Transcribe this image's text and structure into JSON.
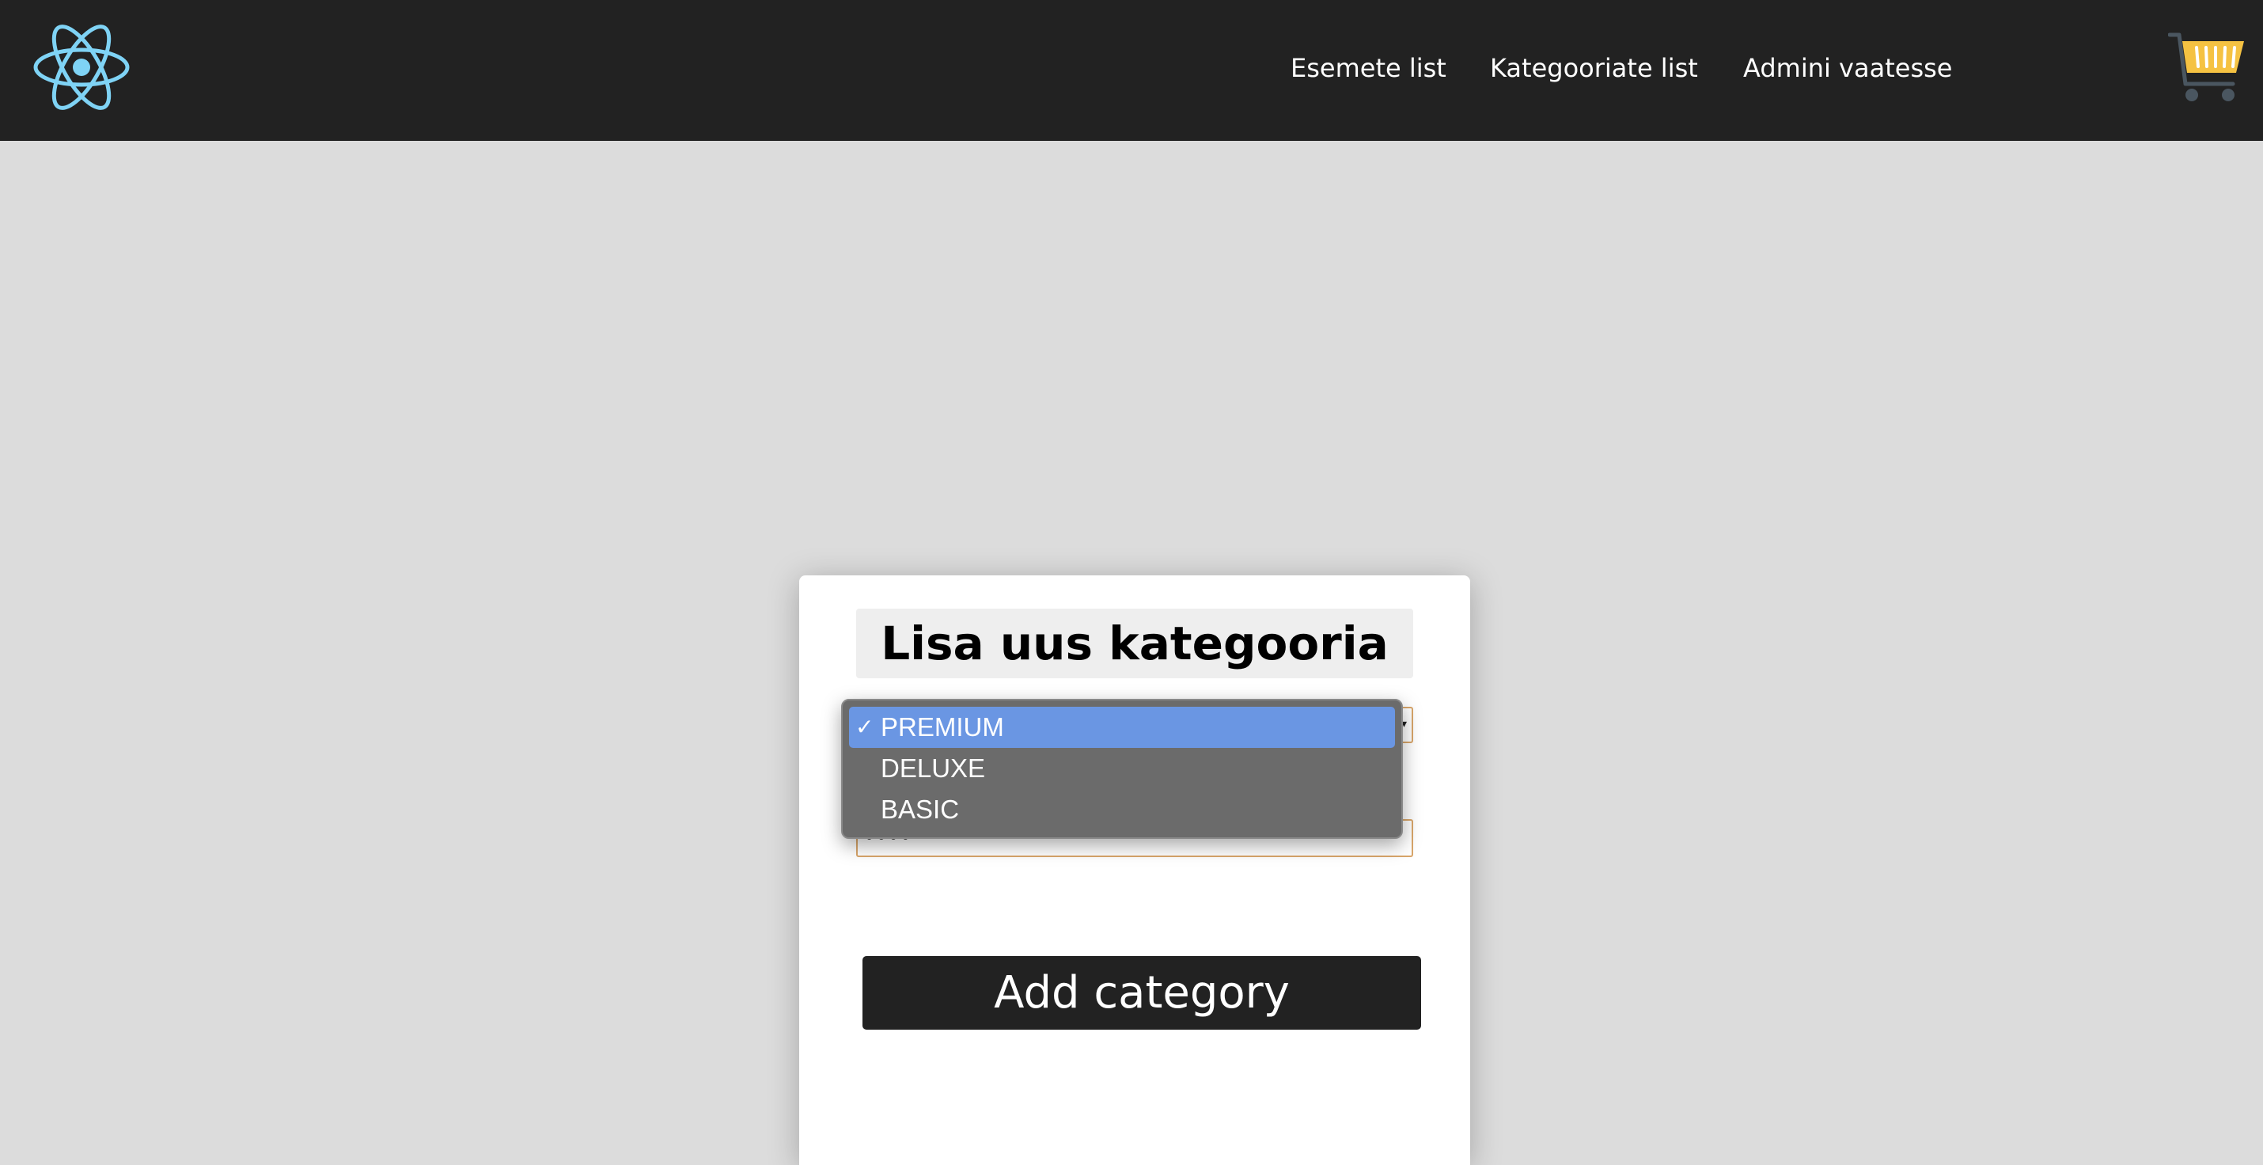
{
  "nav": {
    "logo_icon": "react-atom-icon",
    "links": [
      "Esemete list",
      "Kategooriate list",
      "Admini vaatesse"
    ],
    "cart_icon": "shopping-cart-icon"
  },
  "form": {
    "title": "Lisa uus kategooria",
    "category_select": {
      "options": [
        "PREMIUM",
        "DELUXE",
        "BASIC"
      ],
      "selected": "PREMIUM"
    },
    "password_value": "••••",
    "add_button_label": "Add category"
  },
  "colors": {
    "navbar": "#222222",
    "background": "#dcdcdc",
    "accent_selected": "#6a96e3",
    "logo": "#7fd3f5",
    "cart": "#f5c242"
  }
}
